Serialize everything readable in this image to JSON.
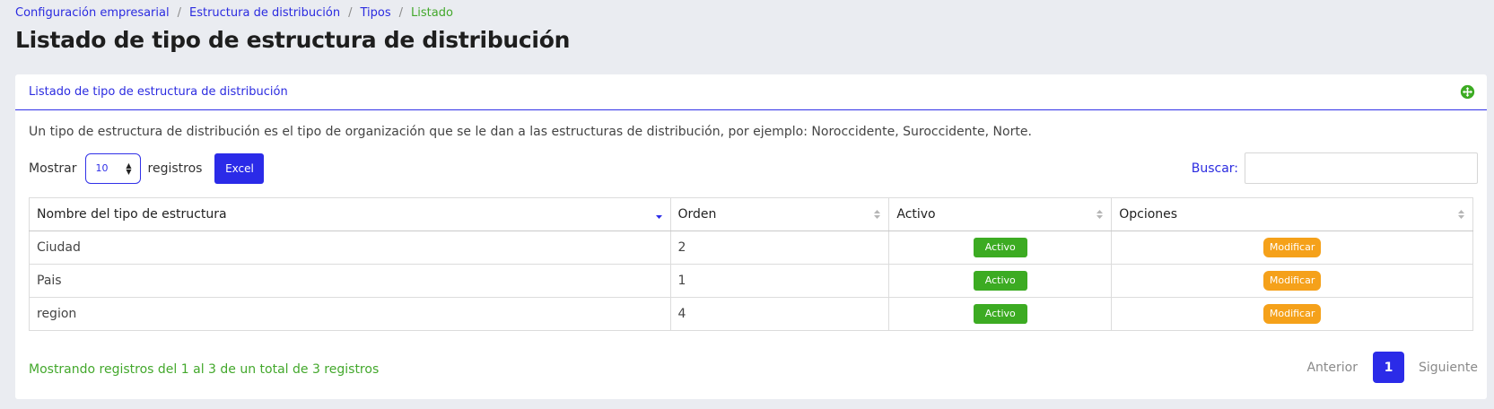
{
  "breadcrumb": {
    "items": [
      "Configuración empresarial",
      "Estructura de distribución",
      "Tipos"
    ],
    "current": "Listado",
    "separator": "/"
  },
  "page_title": "Listado de tipo de estructura de distribución",
  "card": {
    "title": "Listado de tipo de estructura de distribución",
    "expand_icon": "expand-arrows-icon",
    "description": "Un tipo de estructura de distribución es el tipo de organización que se le dan a las estructuras de distribución, por ejemplo: Noroccidente, Suroccidente, Norte."
  },
  "controls": {
    "show_label": "Mostrar",
    "page_size": "10",
    "records_label": "registros",
    "excel_label": "Excel",
    "search_label": "Buscar:",
    "search_value": ""
  },
  "table": {
    "columns": [
      "Nombre del tipo de estructura",
      "Orden",
      "Activo",
      "Opciones"
    ],
    "rows": [
      {
        "name": "Ciudad",
        "order": "2",
        "status": "Activo",
        "action": "Modificar"
      },
      {
        "name": "Pais",
        "order": "1",
        "status": "Activo",
        "action": "Modificar"
      },
      {
        "name": "region",
        "order": "4",
        "status": "Activo",
        "action": "Modificar"
      }
    ]
  },
  "footer": {
    "info": "Mostrando registros del 1 al 3 de un total de 3 registros",
    "prev": "Anterior",
    "page": "1",
    "next": "Siguiente"
  },
  "colors": {
    "accent": "#2b2be8",
    "success": "#3cab22",
    "warning": "#f5a11a",
    "info_text": "#43a82c"
  }
}
